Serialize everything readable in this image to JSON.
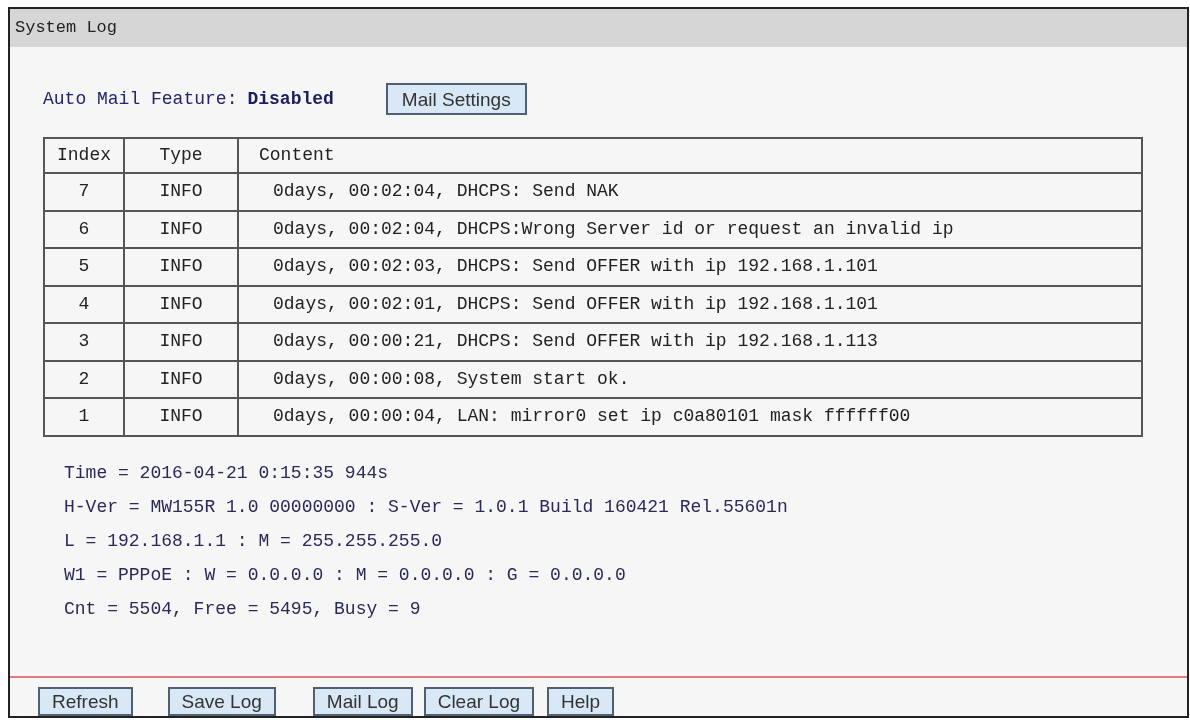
{
  "window": {
    "title": "System Log"
  },
  "auto_mail": {
    "label": "Auto Mail Feature:",
    "value": "Disabled"
  },
  "mail_settings_button": "Mail Settings",
  "table": {
    "columns": [
      "Index",
      "Type",
      "Content"
    ],
    "rows": [
      {
        "index": "7",
        "type": "INFO",
        "content": "0days, 00:02:04, DHCPS: Send NAK"
      },
      {
        "index": "6",
        "type": "INFO",
        "content": "0days, 00:02:04, DHCPS:Wrong Server id or request an invalid ip"
      },
      {
        "index": "5",
        "type": "INFO",
        "content": "0days, 00:02:03, DHCPS: Send OFFER with ip 192.168.1.101"
      },
      {
        "index": "4",
        "type": "INFO",
        "content": "0days, 00:02:01, DHCPS: Send OFFER with ip 192.168.1.101"
      },
      {
        "index": "3",
        "type": "INFO",
        "content": "0days, 00:00:21, DHCPS: Send OFFER with ip 192.168.1.113"
      },
      {
        "index": "2",
        "type": "INFO",
        "content": "0days, 00:00:08, System start ok."
      },
      {
        "index": "1",
        "type": "INFO",
        "content": "0days, 00:00:04, LAN: mirror0 set ip c0a80101 mask ffffff00"
      }
    ]
  },
  "system_info": [
    "Time = 2016-04-21 0:15:35 944s",
    "H-Ver = MW155R 1.0 00000000 : S-Ver = 1.0.1 Build 160421 Rel.55601n",
    "L = 192.168.1.1 : M = 255.255.255.0",
    "W1 = PPPoE : W = 0.0.0.0 : M = 0.0.0.0 : G = 0.0.0.0",
    "Cnt = 5504, Free = 5495, Busy = 9"
  ],
  "buttons": [
    "Refresh",
    "Save Log",
    "Mail Log",
    "Clear Log",
    "Help"
  ]
}
